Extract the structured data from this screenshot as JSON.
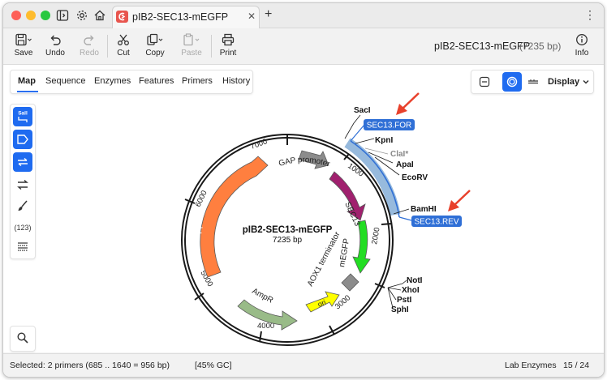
{
  "window": {
    "tab_title": "pIB2-SEC13-mEGFP",
    "new_tab": "+",
    "menu": "⋮"
  },
  "toolbar": {
    "save": "Save",
    "undo": "Undo",
    "redo": "Redo",
    "cut": "Cut",
    "copy": "Copy",
    "paste": "Paste",
    "print": "Print",
    "info": "Info",
    "doc_title": "pIB2-SEC13-mEGFP",
    "doc_length": "(7235 bp)"
  },
  "view_tabs": [
    "Map",
    "Sequence",
    "Enzymes",
    "Features",
    "Primers",
    "History"
  ],
  "active_view": "Map",
  "display_label": "Display",
  "side_tools": {
    "enzyme_label": "SalI",
    "count_label": "(123)"
  },
  "map": {
    "name": "pIB2-SEC13-mEGFP",
    "length": "7235 bp",
    "ticks": [
      "1000",
      "2000",
      "3000",
      "4000",
      "5000",
      "6000",
      "7000"
    ],
    "features": [
      {
        "name": "SEC13",
        "color": "#a0206e"
      },
      {
        "name": "mEGFP",
        "color": "#22dd22"
      },
      {
        "name": "AOX1 terminator",
        "color": "#8c8c8c"
      },
      {
        "name": "ori",
        "color": "#ffff00"
      },
      {
        "name": "AmpR",
        "color": "#99bb88"
      },
      {
        "name": "PpHIS4",
        "color": "#ff7f3f"
      },
      {
        "name": "GAP promoter",
        "color": "#8c8c8c"
      }
    ],
    "enzymes": [
      "SacI",
      "KpnI",
      "ClaI*",
      "ApaI",
      "EcoRV",
      "BamHI",
      "NotI",
      "XhoI",
      "PstI",
      "SphI"
    ],
    "primers": [
      "SEC13.FOR",
      "SEC13.REV"
    ],
    "selection_color": "#8cb3d9",
    "primer_color": "#2f6fd6",
    "arrow_color": "#e8412c"
  },
  "status": {
    "selected": "Selected:  2 primers  (685 .. 1640  =  956 bp)",
    "gc": "[45% GC]",
    "enzyme_set": "Lab Enzymes",
    "enzyme_count": "15 / 24"
  }
}
